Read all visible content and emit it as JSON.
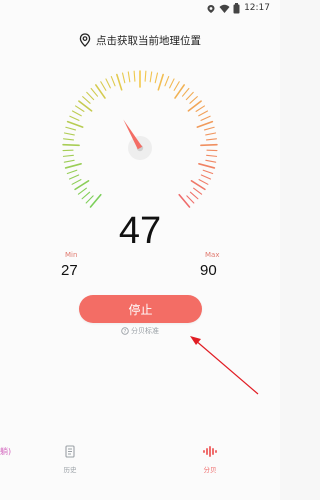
{
  "status_bar": {
    "time": "12:17",
    "icons": [
      "location-icon",
      "wifi-icon",
      "battery-icon"
    ]
  },
  "location": {
    "icon": "location-pin-icon",
    "text": "点击获取当前地理位置"
  },
  "gauge": {
    "value": "47",
    "needle_value": 47,
    "scale_min": 0,
    "scale_max": 120,
    "colors": {
      "low": "#7ccf5a",
      "mid": "#f2c94c",
      "high": "#ef6c6c"
    }
  },
  "minmax": {
    "min_label": "Min",
    "min_value": "27",
    "max_label": "Max",
    "max_value": "90"
  },
  "controls": {
    "stop_label": "停止",
    "stop_color": "#f36d65",
    "info_text": "分贝标准",
    "info_icon": "question-circle-icon"
  },
  "bottom_nav": {
    "left_partial_label": "躺)",
    "items": [
      {
        "label": "历史",
        "icon": "history-icon",
        "color": "#9aa0a6"
      },
      {
        "label": "分贝",
        "icon": "sound-wave-icon",
        "color": "#ef6c6c"
      }
    ]
  }
}
